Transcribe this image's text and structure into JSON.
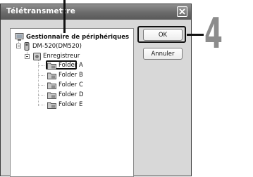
{
  "window": {
    "title": "Télétransmettre"
  },
  "tree": {
    "root_label": "Gestionnaire de périphériques",
    "device_label": "DM-520(DM520)",
    "recorder_label": "Enregistreur",
    "folders": [
      {
        "label": "Folder A",
        "selected": true
      },
      {
        "label": "Folder B",
        "selected": false
      },
      {
        "label": "Folder C",
        "selected": false
      },
      {
        "label": "Folder D",
        "selected": false
      },
      {
        "label": "Folder E",
        "selected": false
      }
    ]
  },
  "buttons": {
    "ok_label": "OK",
    "cancel_label": "Annuler"
  },
  "callout": {
    "step_number": "4"
  },
  "icons": {
    "close": "close-icon",
    "computer": "computer-icon",
    "device": "recorder-device-icon",
    "recorder": "recorder-icon",
    "folder": "folder-icon"
  }
}
